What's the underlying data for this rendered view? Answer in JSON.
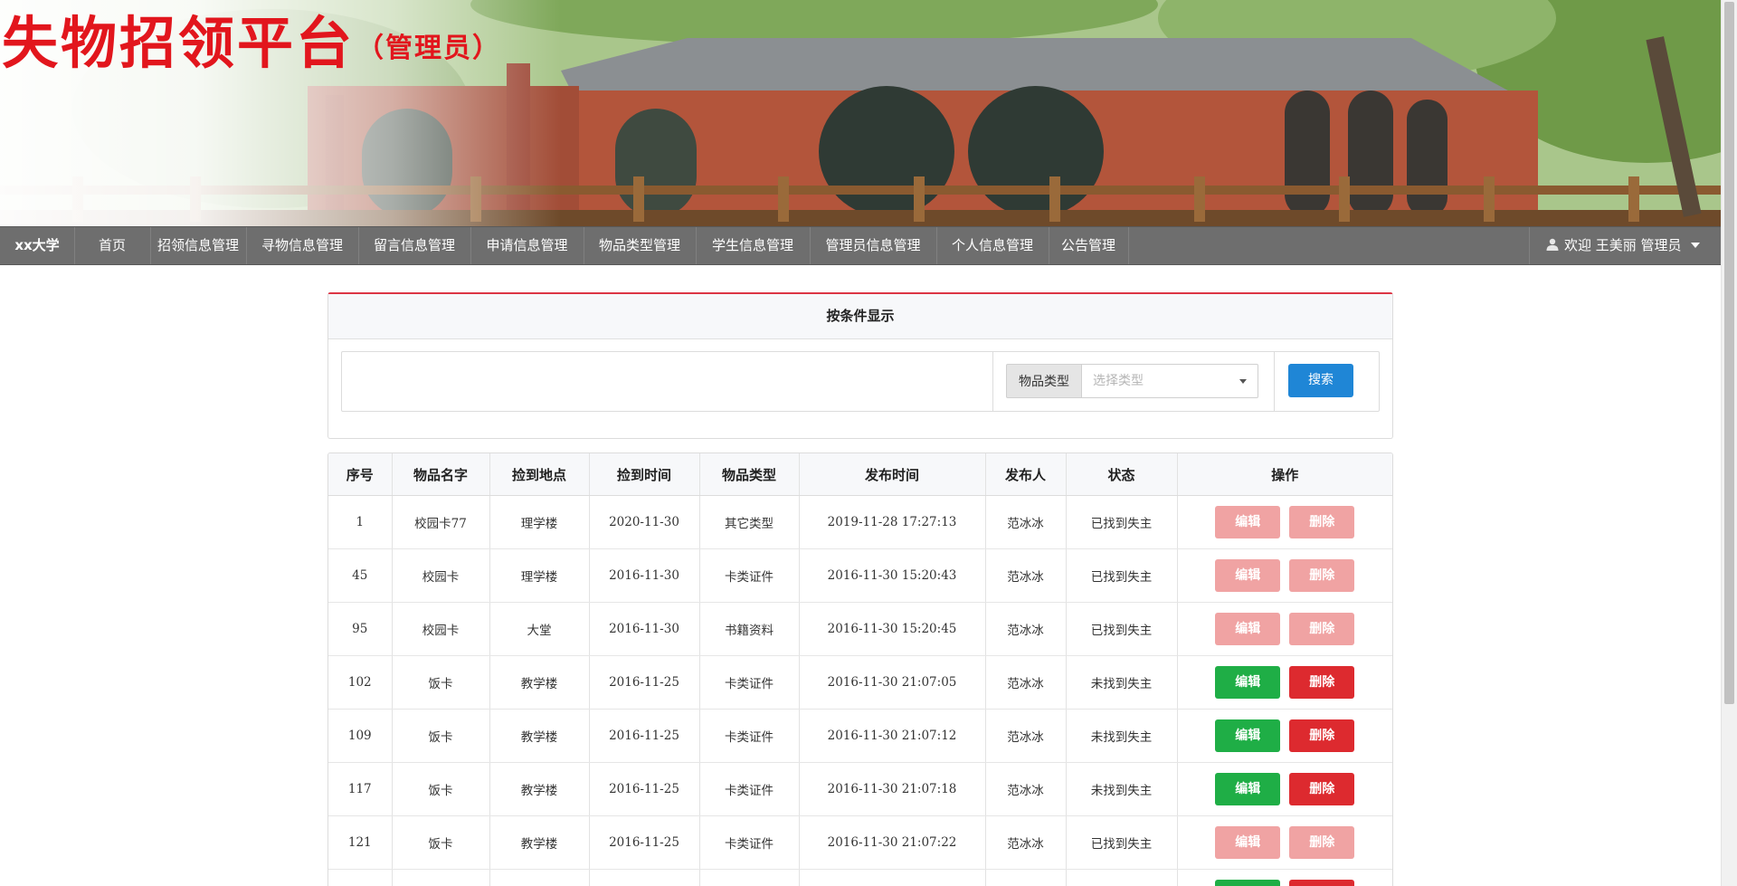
{
  "header": {
    "title": "失物招领平台",
    "subtitle": "（管理员）"
  },
  "nav": {
    "brand": "xx大学",
    "items": [
      {
        "label": "首页",
        "icon": ""
      },
      {
        "label": "招领信息管理"
      },
      {
        "label": "寻物信息管理"
      },
      {
        "label": "留言信息管理"
      },
      {
        "label": "申请信息管理"
      },
      {
        "label": "物品类型管理"
      },
      {
        "label": "学生信息管理"
      },
      {
        "label": "管理员信息管理"
      },
      {
        "label": "个人信息管理"
      },
      {
        "label": "公告管理"
      }
    ],
    "user_icon": "user-icon",
    "user_text": "欢迎 王美丽 管理员"
  },
  "filter": {
    "title": "按条件显示",
    "type_label": "物品类型",
    "type_placeholder": "选择类型",
    "search_label": "搜索"
  },
  "table": {
    "headers": [
      "序号",
      "物品名字",
      "捡到地点",
      "捡到时间",
      "物品类型",
      "发布时间",
      "发布人",
      "状态",
      "操作"
    ],
    "edit_label": "编辑",
    "delete_label": "删除",
    "rows": [
      {
        "id": "1",
        "name": "校园卡77",
        "place": "理学楼",
        "date": "2020-11-30",
        "type": "其它类型",
        "published": "2019-11-28 17:27:13",
        "publisher": "范冰冰",
        "status": "已找到失主",
        "actions_disabled": true
      },
      {
        "id": "45",
        "name": "校园卡",
        "place": "理学楼",
        "date": "2016-11-30",
        "type": "卡类证件",
        "published": "2016-11-30 15:20:43",
        "publisher": "范冰冰",
        "status": "已找到失主",
        "actions_disabled": true
      },
      {
        "id": "95",
        "name": "校园卡",
        "place": "大堂",
        "date": "2016-11-30",
        "type": "书籍资料",
        "published": "2016-11-30 15:20:45",
        "publisher": "范冰冰",
        "status": "已找到失主",
        "actions_disabled": true
      },
      {
        "id": "102",
        "name": "饭卡",
        "place": "教学楼",
        "date": "2016-11-25",
        "type": "卡类证件",
        "published": "2016-11-30 21:07:05",
        "publisher": "范冰冰",
        "status": "未找到失主",
        "actions_disabled": false
      },
      {
        "id": "109",
        "name": "饭卡",
        "place": "教学楼",
        "date": "2016-11-25",
        "type": "卡类证件",
        "published": "2016-11-30 21:07:12",
        "publisher": "范冰冰",
        "status": "未找到失主",
        "actions_disabled": false
      },
      {
        "id": "117",
        "name": "饭卡",
        "place": "教学楼",
        "date": "2016-11-25",
        "type": "卡类证件",
        "published": "2016-11-30 21:07:18",
        "publisher": "范冰冰",
        "status": "未找到失主",
        "actions_disabled": false
      },
      {
        "id": "121",
        "name": "饭卡",
        "place": "教学楼",
        "date": "2016-11-25",
        "type": "卡类证件",
        "published": "2016-11-30 21:07:22",
        "publisher": "范冰冰",
        "status": "已找到失主",
        "actions_disabled": true
      }
    ]
  },
  "colors": {
    "title_red": "#e2161d",
    "nav_bg": "#6e6e6e",
    "edit_green": "#1fae46",
    "delete_red": "#dd2a2f",
    "disabled_pink": "#f0a3a3",
    "search_blue": "#1f86d6"
  }
}
